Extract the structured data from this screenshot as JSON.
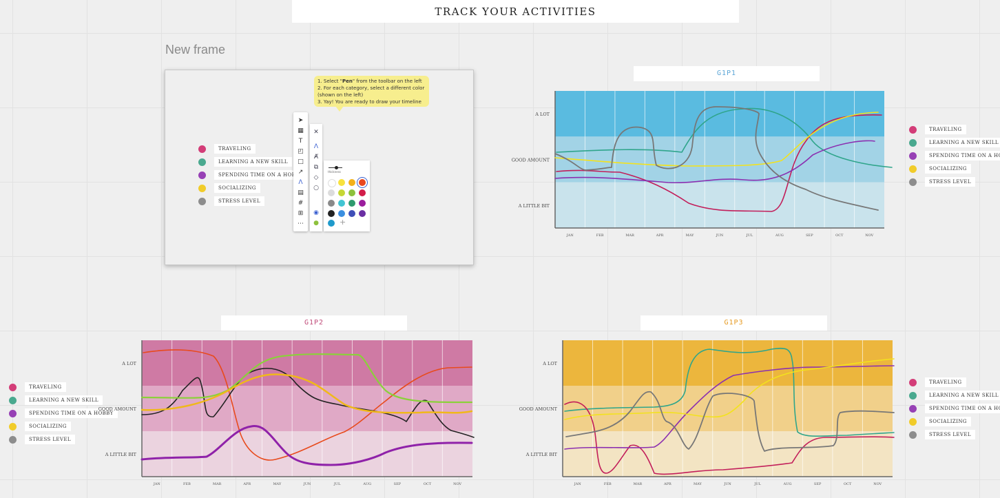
{
  "board_title": "TRACK YOUR ACTIVITIES",
  "frame_label": "New frame",
  "instructions": {
    "line1_prefix": "1. Select \"",
    "line1_bold": "Pen",
    "line1_suffix": "\" from the toolbar on the left",
    "line2": "2. For each category, select a different color",
    "line3": "(shown on the left)",
    "line4": "3. Yay! You are ready to draw your timeline"
  },
  "categories": [
    {
      "label": "TRAVELING",
      "color": "#d33d78"
    },
    {
      "label": "LEARNING A NEW SKILL",
      "color": "#4aa98f"
    },
    {
      "label": "SPENDING TIME ON A HOBBY",
      "color": "#9741b5"
    },
    {
      "label": "SOCIALIZING",
      "color": "#f1cc2a"
    },
    {
      "label": "STRESS LEVEL",
      "color": "#8d8d8d"
    }
  ],
  "toolbar": {
    "tools": [
      "select-arrow-icon",
      "template-icon",
      "text-icon",
      "sticky-note-icon",
      "shape-icon",
      "line-icon",
      "pen-icon",
      "comment-icon",
      "frame-icon",
      "upload-icon",
      "more-icon"
    ],
    "subtools": [
      "close-icon",
      "pen-icon",
      "highlighter-icon",
      "lasso-icon",
      "eraser-icon",
      "comment-icon"
    ],
    "thickness_label": "thickness"
  },
  "palette_colors": [
    [
      "#ffffff",
      "#f8e23e",
      "#f3b11b",
      "#e9471f"
    ],
    [
      "#dcdcdc",
      "#c6d735",
      "#8ec13d",
      "#d21d4a"
    ],
    [
      "#8a8a8a",
      "#42c5d3",
      "#2f9a6e",
      "#9b1e9d"
    ],
    [
      "#222222",
      "#3b8fe0",
      "#3f4fb8",
      "#6a2fa3"
    ]
  ],
  "palette_extra": {
    "current_color": "#1f9acb",
    "add_symbol": "+"
  },
  "y_levels": [
    "A LOT",
    "GOOD AMOUNT",
    "A LITTLE BIT"
  ],
  "months": [
    "JAN",
    "FEB",
    "MAR",
    "APR",
    "MAY",
    "JUN",
    "JUL",
    "AUG",
    "SEP",
    "OCT",
    "NOV"
  ],
  "charts": [
    {
      "id": "G1P1",
      "title_color": "#5aa5d6",
      "band_colors": [
        "#5abbe0",
        "#a2d3e6",
        "#c9e3ec"
      ]
    },
    {
      "id": "G1P2",
      "title_color": "#c04b79",
      "band_colors": [
        "#cf7aa4",
        "#e0a9c6",
        "#ebd3df"
      ]
    },
    {
      "id": "G1P3",
      "title_color": "#e69a22",
      "band_colors": [
        "#ecb63d",
        "#f1d08a",
        "#f3e4c3"
      ]
    }
  ]
}
